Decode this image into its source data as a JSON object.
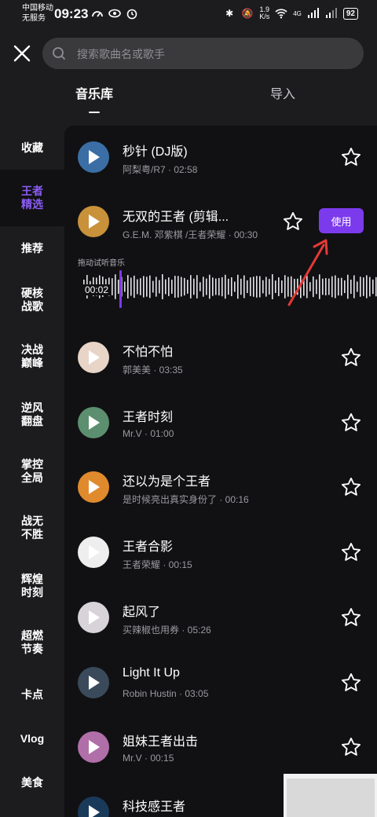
{
  "status_bar": {
    "carrier_line1": "中国移动",
    "carrier_line2": "无服务",
    "time": "09:23",
    "net_speed_value": "1.9",
    "net_speed_unit": "K/s",
    "signal_label": "4G",
    "battery": "92"
  },
  "header": {
    "search_placeholder": "搜索歌曲名或歌手"
  },
  "tabs": [
    {
      "label": "音乐库"
    },
    {
      "label": "导入"
    }
  ],
  "sidebar": {
    "items": [
      {
        "label": "收藏"
      },
      {
        "label": "王者\n精选"
      },
      {
        "label": "推荐"
      },
      {
        "label": "硬核\n战歌"
      },
      {
        "label": "决战\n巅峰"
      },
      {
        "label": "逆风\n翻盘"
      },
      {
        "label": "掌控\n全局"
      },
      {
        "label": "战无\n不胜"
      },
      {
        "label": "辉煌\n时刻"
      },
      {
        "label": "超燃\n节奏"
      },
      {
        "label": "卡点"
      },
      {
        "label": "Vlog"
      },
      {
        "label": "美食"
      }
    ],
    "active_index": 1
  },
  "songs": [
    {
      "title": "秒针 (DJ版)",
      "meta": "阿梨粤/R7 · 02:58",
      "cover_color": "#3b6ea5"
    },
    {
      "title": "无双的王者 (剪辑...",
      "meta": "G.E.M. 邓紫棋 /王者荣耀 · 00:30",
      "cover_color": "#c8913a"
    },
    {
      "title": "不怕不怕",
      "meta": "郭美美 · 03:35",
      "cover_color": "#e8d5c8"
    },
    {
      "title": "王者时刻",
      "meta": "Mr.V · 01:00",
      "cover_color": "#5b8f6f"
    },
    {
      "title": "还以为是个王者",
      "meta": "是时候亮出真实身份了 · 00:16",
      "cover_color": "#e08a2e"
    },
    {
      "title": "王者合影",
      "meta": "王者荣耀 · 00:15",
      "cover_color": "#eeeeee"
    },
    {
      "title": "起风了",
      "meta": "买辣椒也用券 · 05:26",
      "cover_color": "#d8d3d8"
    },
    {
      "title": "Light It Up",
      "meta": "Robin Hustin · 03:05",
      "cover_color": "#3a4a5a"
    },
    {
      "title": "姐妹王者出击",
      "meta": "Mr.V · 00:15",
      "cover_color": "#b06fa8"
    },
    {
      "title": "科技感王者",
      "meta": "",
      "cover_color": "#1a3a5a"
    }
  ],
  "selected_song": {
    "use_label": "使用",
    "drag_hint": "拖动试听音乐",
    "current_time": "00:02"
  },
  "colors": {
    "accent": "#7c3aed",
    "background": "#1c1c1e",
    "list_background": "#111113"
  },
  "icons": {
    "close": "close-icon",
    "search": "search-icon",
    "favorite": "star-outline-icon",
    "play": "play-icon"
  }
}
